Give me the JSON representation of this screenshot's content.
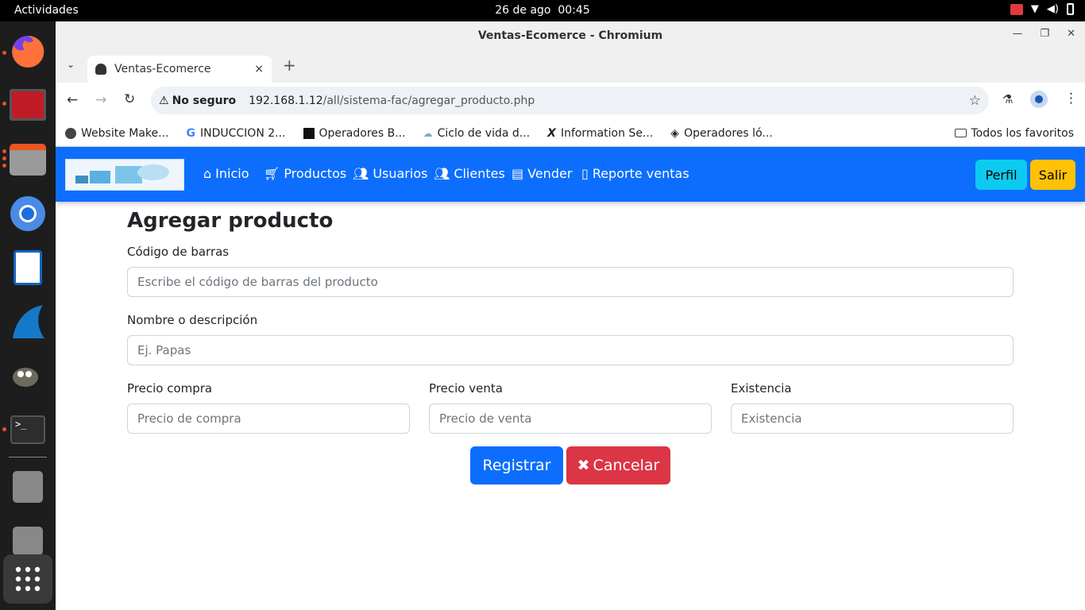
{
  "system": {
    "activities": "Actividades",
    "date": "26 de ago",
    "time": "00:45"
  },
  "window": {
    "title": "Ventas-Ecomerce - Chromium"
  },
  "tab": {
    "label": "Ventas-Ecomerce",
    "close": "×",
    "new_tab": "+"
  },
  "address": {
    "security": "No seguro",
    "host": "192.168.1.12",
    "path": "/all/sistema-fac/agregar_producto.php"
  },
  "bookmarks": [
    {
      "label": "Website Make..."
    },
    {
      "label": "INDUCCION 2..."
    },
    {
      "label": "Operadores B..."
    },
    {
      "label": "Ciclo de vida d..."
    },
    {
      "label": "Information Se..."
    },
    {
      "label": "Operadores ló..."
    }
  ],
  "bookmarks_all": "Todos los favoritos",
  "nav": {
    "items": [
      {
        "label": "Inicio",
        "icon": "home-icon"
      },
      {
        "label": "Productos",
        "icon": "cart-icon"
      },
      {
        "label": "Usuarios",
        "icon": "users-icon"
      },
      {
        "label": "Clientes",
        "icon": "user-group-icon"
      },
      {
        "label": "Vender",
        "icon": "cash-register-icon"
      },
      {
        "label": "Reporte ventas",
        "icon": "file-icon"
      }
    ],
    "perfil": "Perfil",
    "salir": "Salir"
  },
  "form": {
    "heading": "Agregar producto",
    "barcode_label": "Código de barras",
    "barcode_placeholder": "Escribe el código de barras del producto",
    "name_label": "Nombre o descripción",
    "name_placeholder": "Ej. Papas",
    "buy_label": "Precio compra",
    "buy_placeholder": "Precio de compra",
    "sell_label": "Precio venta",
    "sell_placeholder": "Precio de venta",
    "stock_label": "Existencia",
    "stock_placeholder": "Existencia",
    "submit": "Registrar",
    "cancel": "Cancelar"
  },
  "colors": {
    "primary": "#0d6efd",
    "info": "#0dcaf0",
    "warning": "#ffc107",
    "danger": "#dc3545"
  }
}
